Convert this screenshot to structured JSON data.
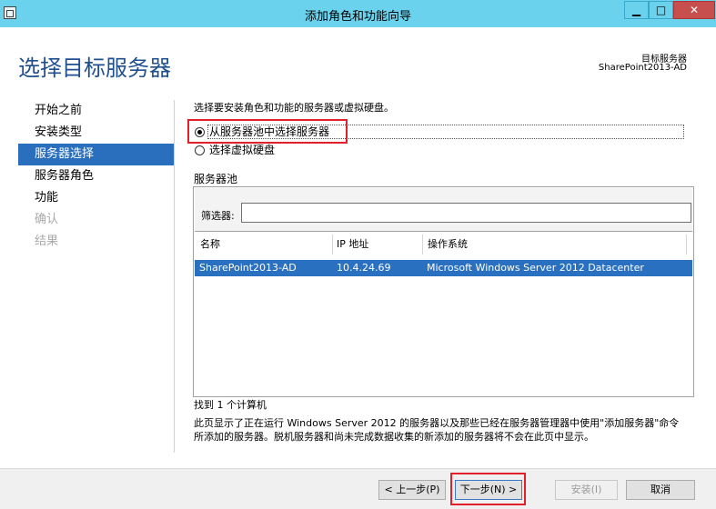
{
  "window": {
    "title": "添加角色和功能向导",
    "minimize_label": "▁",
    "maximize_label": "□",
    "close_label": "✕"
  },
  "header": {
    "page_title": "选择目标服务器",
    "destination_label": "目标服务器",
    "destination_value": "SharePoint2013-AD"
  },
  "nav": {
    "items": [
      {
        "label": "开始之前",
        "state": "normal"
      },
      {
        "label": "安装类型",
        "state": "normal"
      },
      {
        "label": "服务器选择",
        "state": "active"
      },
      {
        "label": "服务器角色",
        "state": "normal"
      },
      {
        "label": "功能",
        "state": "normal"
      },
      {
        "label": "确认",
        "state": "disabled"
      },
      {
        "label": "结果",
        "state": "disabled"
      }
    ]
  },
  "main": {
    "intro": "选择要安装角色和功能的服务器或虚拟硬盘。",
    "options": [
      {
        "label": "从服务器池中选择服务器",
        "selected": true
      },
      {
        "label": "选择虚拟硬盘",
        "selected": false
      }
    ],
    "pool": {
      "title": "服务器池",
      "filter_label": "筛选器:",
      "filter_value": "",
      "columns": [
        "名称",
        "IP 地址",
        "操作系统"
      ],
      "rows": [
        {
          "name": "SharePoint2013-AD",
          "ip": "10.4.24.69",
          "os": "Microsoft Windows Server 2012 Datacenter",
          "selected": true
        }
      ]
    },
    "found_text": "找到 1 个计算机",
    "description": "此页显示了正在运行 Windows Server 2012 的服务器以及那些已经在服务器管理器中使用\"添加服务器\"命令所添加的服务器。脱机服务器和尚未完成数据收集的新添加的服务器将不会在此页中显示。"
  },
  "footer": {
    "prev_label": "< 上一步(P)",
    "next_label": "下一步(N) >",
    "install_label": "安装(I)",
    "cancel_label": "取消"
  },
  "colors": {
    "titlebar": "#6bd2ee",
    "accent": "#2a6fbe",
    "highlight_annotation": "#e2202b"
  }
}
